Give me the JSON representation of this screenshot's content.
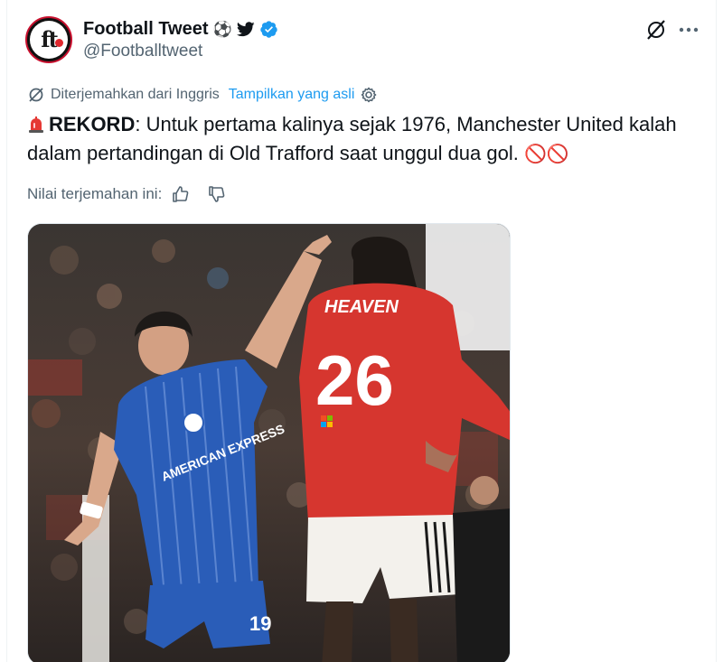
{
  "account": {
    "display_name": "Football Tweet",
    "name_emoji": "⚽",
    "handle": "@Footballtweet",
    "avatar_text": "ft"
  },
  "translation": {
    "label": "Diterjemahkan dari Inggris",
    "show_original": "Tampilkan yang asli"
  },
  "tweet": {
    "bold_prefix": "REKORD",
    "text": ": Untuk pertama kalinya sejak 1976, Manchester United kalah dalam pertandingan di Old Trafford saat unggul dua gol. ",
    "trailing_emoji": "🚫🚫"
  },
  "rate": {
    "label": "Nilai terjemahan ini:"
  },
  "media": {
    "jersey_name": "HEAVEN",
    "jersey_number": "26",
    "sponsor_left": "AMERICAN EXPRESS",
    "shorts_number": "19",
    "sleeve_sponsor": "Microsoft Surface"
  },
  "colors": {
    "link": "#1d9bf0",
    "muted": "#536471",
    "verified": "#1d9bf0",
    "brighton_blue": "#2a5db8",
    "united_red": "#d6362f"
  },
  "icons": [
    "verified-badge-icon",
    "twitter-bird-icon",
    "grok-icon",
    "more-icon",
    "translate-icon",
    "settings-icon",
    "thumbs-up-icon",
    "thumbs-down-icon",
    "siren-icon"
  ]
}
